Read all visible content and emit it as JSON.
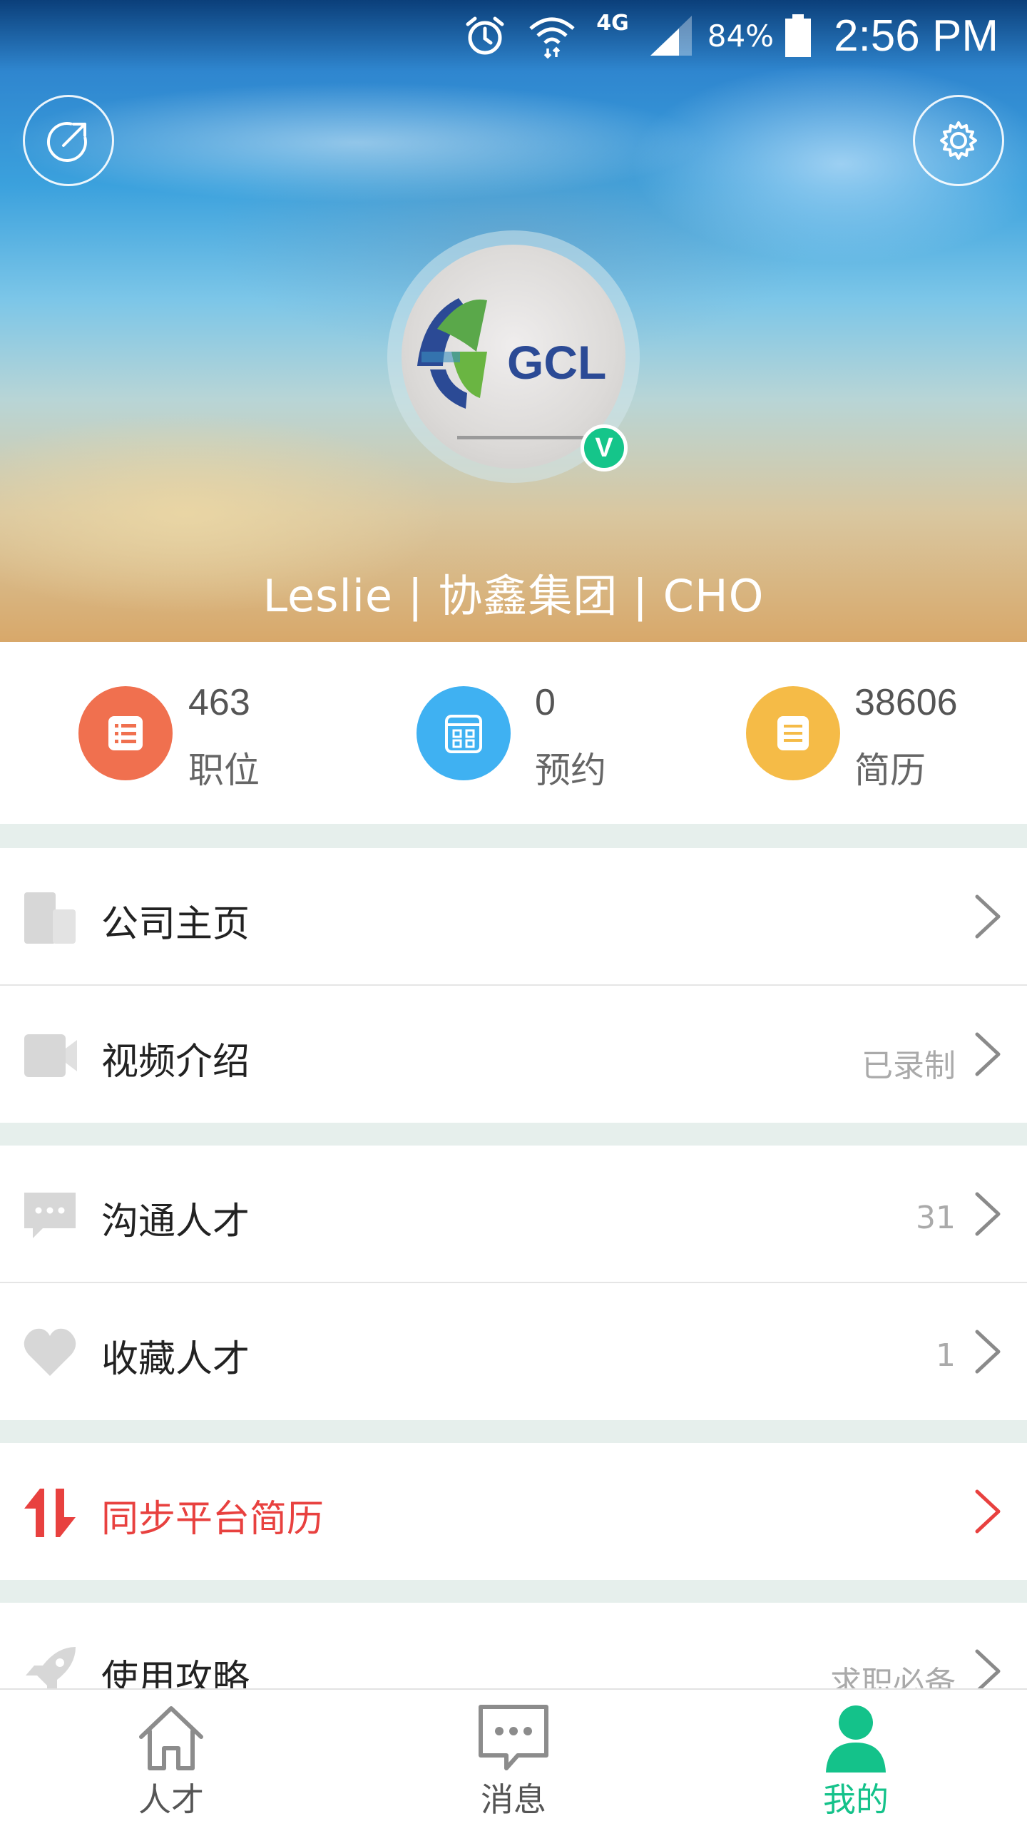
{
  "status_bar": {
    "network": "4G",
    "battery": "84%",
    "time": "2:56 PM",
    "icons": [
      "alarm-icon",
      "wifi-icon",
      "signal-icon",
      "battery-icon"
    ]
  },
  "profile": {
    "name": "Leslie | 协鑫集团 | CHO",
    "verified_badge": "V",
    "avatar_logo_text": "GCL"
  },
  "stats": [
    {
      "value": "463",
      "label": "职位",
      "icon": "list-icon",
      "color": "#f0704f"
    },
    {
      "value": "0",
      "label": "预约",
      "icon": "calendar-icon",
      "color": "#3fb1f2"
    },
    {
      "value": "38606",
      "label": "简历",
      "icon": "document-icon",
      "color": "#f5bb47"
    }
  ],
  "menu": [
    {
      "label": "公司主页",
      "value": "",
      "icon": "building-icon"
    },
    {
      "label": "视频介绍",
      "value": "已录制",
      "icon": "video-camera-icon"
    },
    {
      "label": "沟通人才",
      "value": "31",
      "icon": "chat-bubble-icon"
    },
    {
      "label": "收藏人才",
      "value": "1",
      "icon": "heart-icon"
    },
    {
      "label": "同步平台简历",
      "value": "",
      "icon": "sync-arrows-icon",
      "color": "#e8413f"
    },
    {
      "label": "使用攻略",
      "value": "求职必备",
      "icon": "rocket-icon"
    }
  ],
  "tabs": [
    {
      "label": "人才",
      "icon": "home-icon",
      "active": false
    },
    {
      "label": "消息",
      "icon": "message-icon",
      "active": false
    },
    {
      "label": "我的",
      "icon": "person-icon",
      "active": true
    }
  ],
  "colors": {
    "accent": "#14c28a",
    "highlight": "#e8413f",
    "section_gap": "#e6efec"
  }
}
